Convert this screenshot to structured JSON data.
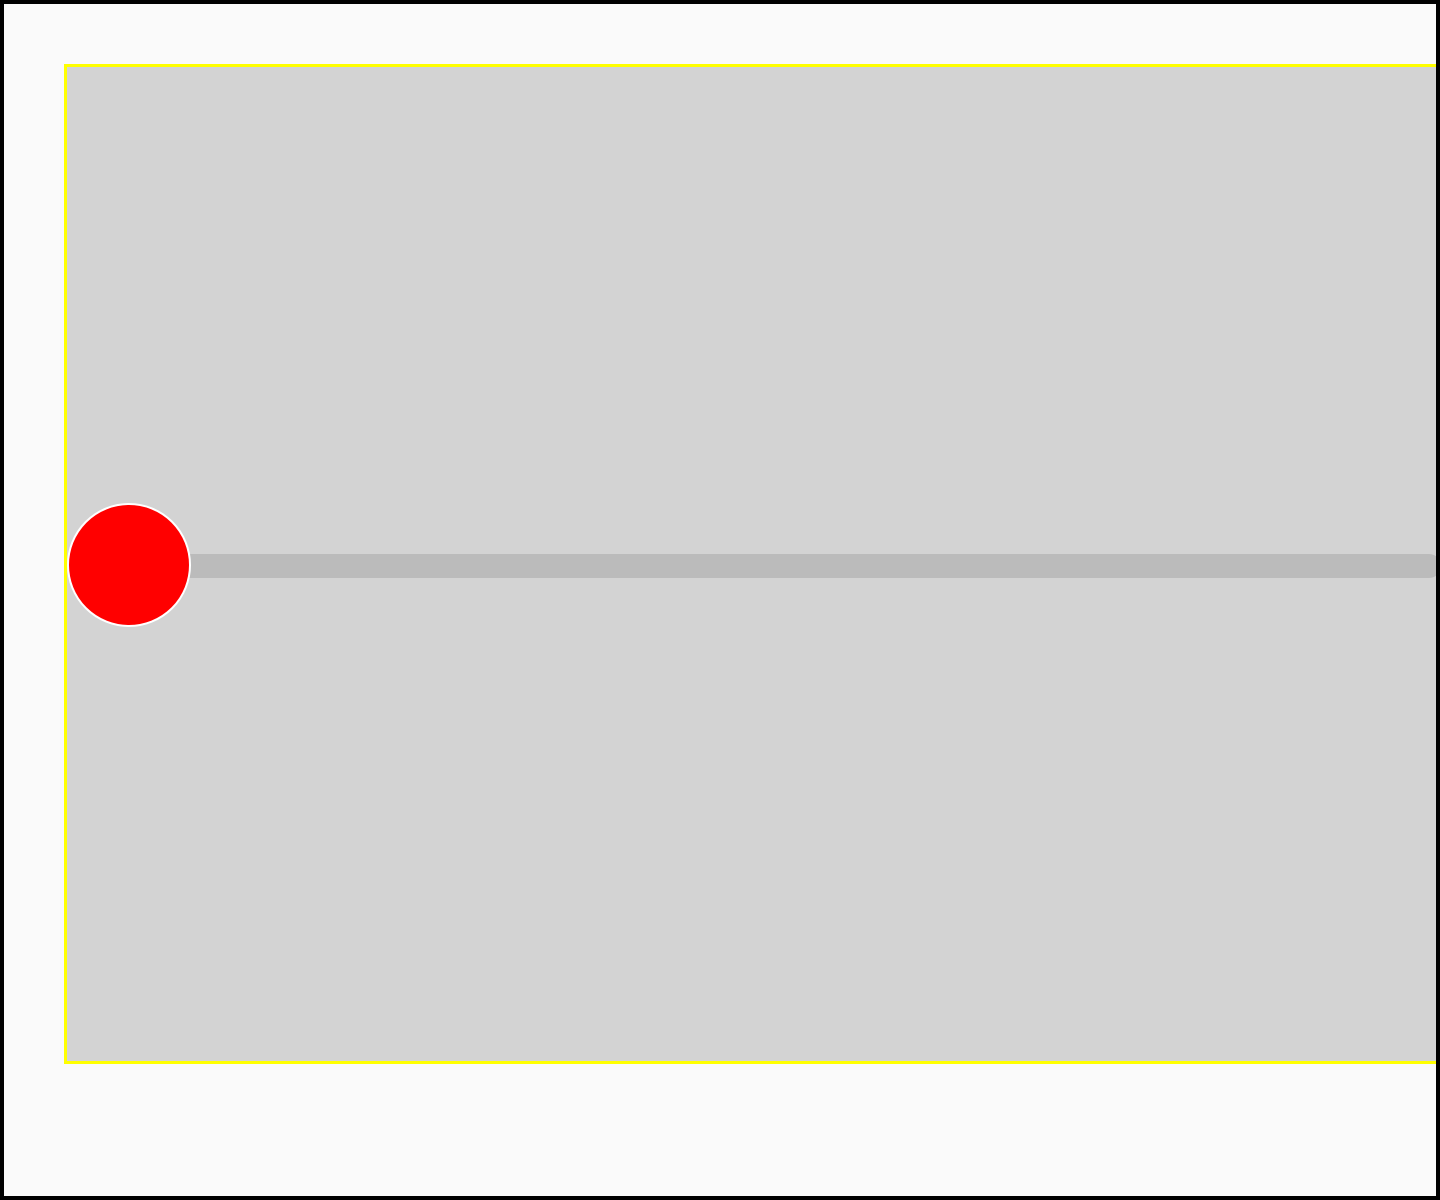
{
  "colors": {
    "frame": "#000000",
    "page_background": "#fafafa",
    "panel_border": "#ffff00",
    "panel_background": "#d3d3d3",
    "track": "#bbbbbb",
    "thumb": "#ff0000",
    "thumb_border": "#ffffff"
  },
  "slider": {
    "value_fraction": 0.0
  }
}
